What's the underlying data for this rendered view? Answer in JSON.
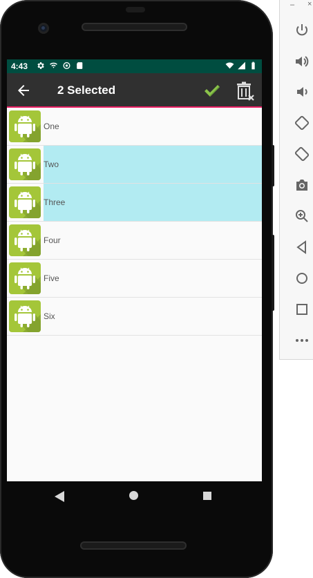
{
  "status_bar": {
    "time": "4:43",
    "left_icons": [
      "gear-icon",
      "wifi-calling-icon",
      "sync-icon",
      "sd-card-icon"
    ],
    "right_icons": [
      "wifi-icon",
      "signal-icon",
      "battery-icon"
    ]
  },
  "toolbar": {
    "title": "2 Selected",
    "back_icon": "arrow-back-icon",
    "confirm_icon": "check-icon",
    "delete_icon": "delete-icon"
  },
  "list": {
    "items": [
      {
        "label": "One",
        "selected": false
      },
      {
        "label": "Two",
        "selected": true
      },
      {
        "label": "Three",
        "selected": true
      },
      {
        "label": "Four",
        "selected": false
      },
      {
        "label": "Five",
        "selected": false
      },
      {
        "label": "Six",
        "selected": false
      }
    ]
  },
  "nav_bar": {
    "buttons": [
      "back",
      "home",
      "recents"
    ]
  },
  "emulator_panel": {
    "buttons": [
      "power-icon",
      "volume-up-icon",
      "volume-down-icon",
      "rotate-left-icon",
      "rotate-right-icon",
      "camera-icon",
      "zoom-icon",
      "back-icon",
      "home-icon",
      "overview-icon",
      "more-icon"
    ]
  },
  "colors": {
    "status_bar": "#004d40",
    "toolbar": "#303030",
    "accent": "#e91e63",
    "selection": "#b2ebf2",
    "android_green": "#a4c639",
    "check": "#7cb342"
  }
}
